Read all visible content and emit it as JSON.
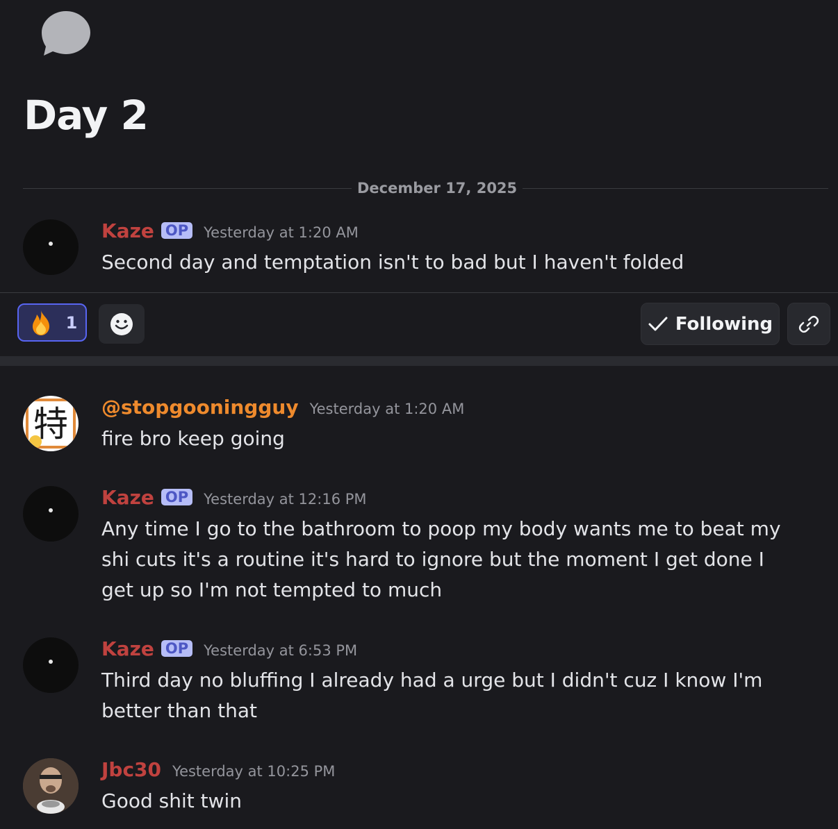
{
  "thread": {
    "icon": "speech-bubble-icon",
    "title": "Day 2",
    "date_divider": "December 17, 2025"
  },
  "op_message": {
    "username": "Kaze",
    "badge": "OP",
    "time": "Yesterday at 1:20 AM",
    "text": "Second day and temptation isn't to bad but I haven't folded"
  },
  "actions": {
    "reaction_emoji": "fire-emoji",
    "reaction_count": "1",
    "add_reaction_icon": "smile-icon",
    "following_label": "Following",
    "link_icon": "link-icon"
  },
  "messages": [
    {
      "username": "@stopgooningguy",
      "time": "Yesterday at 1:20 AM",
      "text": "fire bro keep going",
      "avatar_glyph": "特",
      "name_color": "#ee8a2d"
    },
    {
      "username": "Kaze",
      "badge": "OP",
      "time": "Yesterday at 12:16 PM",
      "text": "Any time I go to the bathroom to poop my body wants me to beat my shi cuts it's a routine it's hard to ignore but the moment I get done I get up so I'm not tempted to much"
    },
    {
      "username": "Kaze",
      "badge": "OP",
      "time": "Yesterday at 6:53 PM",
      "text": "Third day no bluffing I already had a urge but I didn't cuz I know I'm better than that"
    },
    {
      "username": "Jbc30",
      "time": "Yesterday at 10:25 PM",
      "text": "Good shit twin"
    }
  ],
  "colors": {
    "background": "#1a1a1e",
    "op_name": "#c0423f",
    "accent": "#5865f2"
  }
}
